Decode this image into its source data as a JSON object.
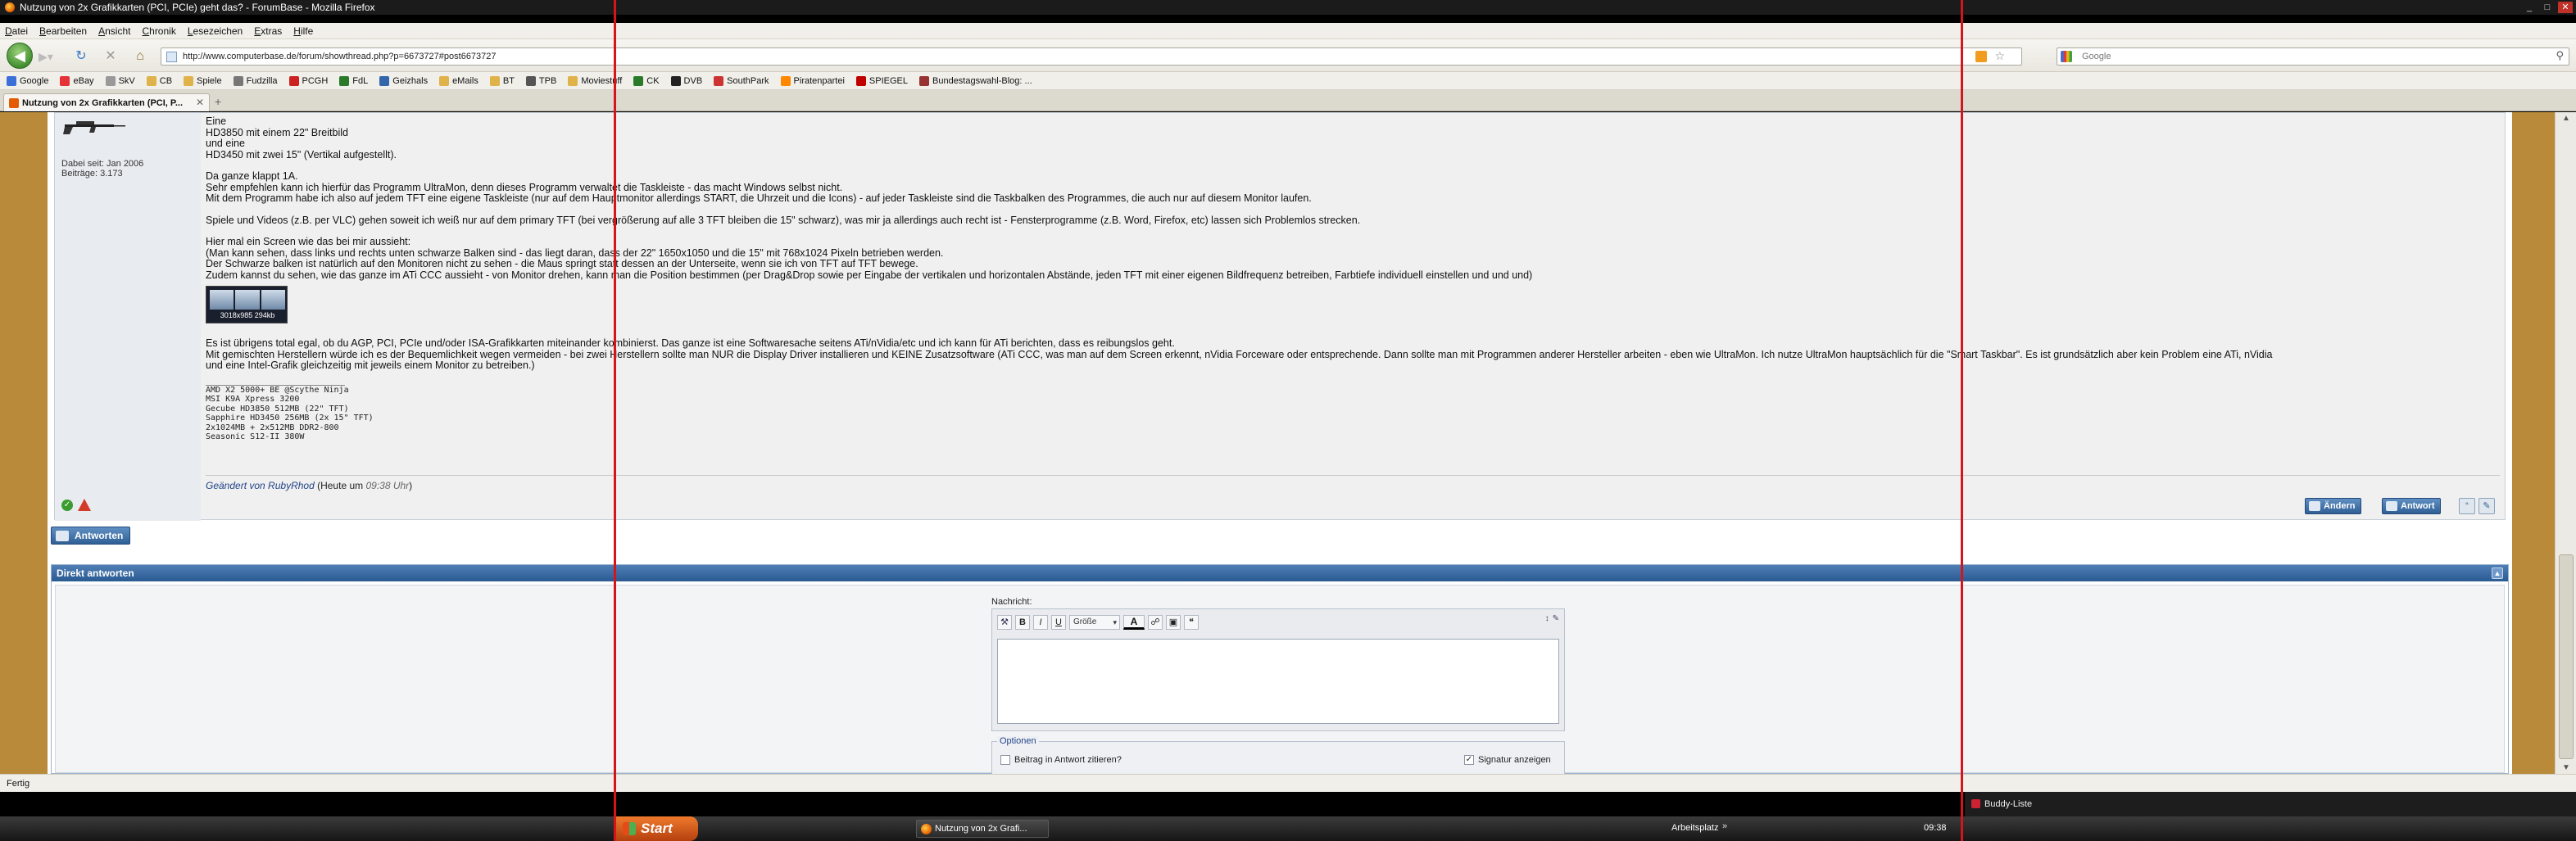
{
  "window": {
    "title": "Nutzung von 2x Grafikkarten (PCI, PCIe) geht das? - ForumBase - Mozilla Firefox",
    "controls": [
      "_",
      "□",
      "✕"
    ]
  },
  "menu": [
    "Datei",
    "Bearbeiten",
    "Ansicht",
    "Chronik",
    "Lesezeichen",
    "Extras",
    "Hilfe"
  ],
  "nav": {
    "url": "http://www.computerbase.de/forum/showthread.php?p=6673727#post6673727",
    "search_placeholder": "Google"
  },
  "bookmarks": [
    {
      "label": "Google",
      "color": "#3d6fd9"
    },
    {
      "label": "eBay",
      "color": "#e53238"
    },
    {
      "label": "SkV",
      "color": "#999999"
    },
    {
      "label": "CB",
      "color": "#e0b24a"
    },
    {
      "label": "Spiele",
      "color": "#e0b24a"
    },
    {
      "label": "Fudzilla",
      "color": "#777777"
    },
    {
      "label": "PCGH",
      "color": "#cc2222"
    },
    {
      "label": "FdL",
      "color": "#2a7a2a"
    },
    {
      "label": "Geizhals",
      "color": "#3366aa"
    },
    {
      "label": "eMails",
      "color": "#e0b24a"
    },
    {
      "label": "BT",
      "color": "#e0b24a"
    },
    {
      "label": "TPB",
      "color": "#555555"
    },
    {
      "label": "Moviestuff",
      "color": "#e0b24a"
    },
    {
      "label": "CK",
      "color": "#2a7a2a"
    },
    {
      "label": "DVB",
      "color": "#222222"
    },
    {
      "label": "SouthPark",
      "color": "#cc3333"
    },
    {
      "label": "Piratenpartei",
      "color": "#ff8800"
    },
    {
      "label": "SPIEGEL",
      "color": "#c00000"
    },
    {
      "label": "Bundestagswahl-Blog: ...",
      "color": "#993333"
    }
  ],
  "tab": {
    "label": "Nutzung von 2x Grafikkarten (PCI, P...",
    "newtab": "+"
  },
  "post": {
    "user_joined": "Dabei seit: Jan 2006",
    "user_posts": "Beiträge: 3.173",
    "lines": [
      "Eine",
      "HD3850 mit einem 22\" Breitbild",
      "und eine",
      "HD3450 mit zwei 15\" (Vertikal aufgestellt).",
      "",
      "Da ganze klappt 1A.",
      "Sehr empfehlen kann ich hierfür das Programm UltraMon, denn dieses Programm verwaltet die Taskleiste - das macht Windows selbst nicht.",
      "Mit dem Programm habe ich also auf jedem TFT eine eigene Taskleiste (nur auf dem Hauptmonitor allerdings START, die Uhrzeit und die Icons) - auf jeder Taskleiste sind die Taskbalken des Programmes, die auch nur auf diesem Monitor laufen.",
      "",
      "Spiele und Videos (z.B. per VLC) gehen soweit ich weiß nur auf dem primary TFT (bei vergrößerung auf alle 3 TFT bleiben die 15\" schwarz), was mir ja allerdings auch recht ist - Fensterprogramme (z.B. Word, Firefox, etc) lassen sich Problemlos strecken.",
      "",
      "Hier mal ein Screen wie das bei mir aussieht:",
      "(Man kann sehen, dass links und rechts unten schwarze Balken sind - das liegt daran, dass der 22\" 1650x1050 und die 15\" mit 768x1024 Pixeln betrieben werden.",
      "Der Schwarze balken ist natürlich auf den Monitoren nicht zu sehen - die Maus springt statt dessen an der Unterseite, wenn sie ich von TFT auf TFT bewege.",
      "Zudem kannst du sehen, wie das ganze im ATi CCC aussieht - von Monitor drehen, kann man die Position bestimmen (per Drag&Drop sowie per Eingabe der vertikalen und horizontalen Abstände, jeden TFT mit einer eigenen Bildfrequenz betreiben, Farbtiefe individuell einstellen und und und)"
    ],
    "thumbnail_caption": "3018x985 294kb",
    "lines2": [
      "Es ist übrigens total egal, ob du AGP, PCI, PCIe und/oder ISA-Grafikkarten miteinander kombinierst. Das ganze ist eine Softwaresache seitens ATi/nVidia/etc und ich kann für ATi berichten, dass es reibungslos geht.",
      "Mit gemischten Herstellern würde ich es der Bequemlichkeit wegen vermeiden - bei zwei Herstellern sollte man NUR die Display Driver installieren und KEINE Zusatzsoftware (ATi CCC, was man auf dem Screen erkennt, nVidia Forceware oder entsprechende. Dann sollte man mit Programmen anderer Hersteller arbeiten - eben wie UltraMon. Ich nutze UltraMon hauptsächlich für die \"Smart Taskbar\". Es ist grundsätzlich aber kein Problem eine ATi, nVidia",
      "und eine Intel-Grafik gleichzeitig mit jeweils einem Monitor zu betreiben.)"
    ],
    "signature": [
      "AMD X2 5000+ BE @Scythe Ninja",
      "MSI K9A Xpress 3200",
      "Gecube HD3850 512MB (22\" TFT)",
      "Sapphire HD3450 256MB (2x 15\" TFT)",
      "2x1024MB + 2x512MB DDR2-800",
      "Seasonic S12-II 380W"
    ],
    "edited_by": "Geändert von RubyRhod",
    "edited_time_pre": "(Heute um",
    "edited_time": "09:38 Uhr",
    "edited_time_post": ")",
    "buttons": {
      "edit": "Ändern",
      "reply": "Antwort"
    }
  },
  "reply_button": "Antworten",
  "quick_reply": {
    "title": "Direkt antworten",
    "message_label": "Nachricht:",
    "size_select": "Größe",
    "options_legend": "Optionen",
    "quote_label": "Beitrag in Antwort zitieren?",
    "sig_label": "Signatur anzeigen"
  },
  "status": "Fertig",
  "taskbar": {
    "start": "Start",
    "item": "Nutzung von 2x Grafi...",
    "tray_label": "Arbeitsplatz",
    "tray_arrow": "»",
    "clock": "09:38",
    "buddy": "Buddy-Liste"
  }
}
